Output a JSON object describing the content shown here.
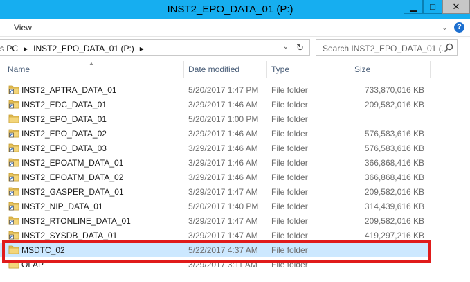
{
  "window": {
    "title": "INST2_EPO_DATA_01 (P:)",
    "controls": {
      "minimize": "▁",
      "maximize": "□",
      "close": "✕"
    }
  },
  "ribbon": {
    "tab_view": "View",
    "expand": "⌄",
    "help": "?"
  },
  "address_bar": {
    "crumbs": [
      "s PC",
      "INST2_EPO_DATA_01 (P:)"
    ],
    "separator": "▶",
    "dropdown": "⌄",
    "refresh": "↻"
  },
  "search": {
    "placeholder": "Search INST2_EPO_DATA_01 (..."
  },
  "columns": {
    "name": "Name",
    "date": "Date modified",
    "type": "Type",
    "size": "Size",
    "sort_indicator": "▲"
  },
  "rows": [
    {
      "name": "INST2_APTRA_DATA_01",
      "date": "5/20/2017 1:47 PM",
      "type": "File folder",
      "size": "733,870,016 KB",
      "icon": "folder-shortcut-icon"
    },
    {
      "name": "INST2_EDC_DATA_01",
      "date": "3/29/2017 1:46 AM",
      "type": "File folder",
      "size": "209,582,016 KB",
      "icon": "folder-shortcut-icon"
    },
    {
      "name": "INST2_EPO_DATA_01",
      "date": "5/20/2017 1:00 PM",
      "type": "File folder",
      "size": "",
      "icon": "folder-icon"
    },
    {
      "name": "INST2_EPO_DATA_02",
      "date": "3/29/2017 1:46 AM",
      "type": "File folder",
      "size": "576,583,616 KB",
      "icon": "folder-shortcut-icon"
    },
    {
      "name": "INST2_EPO_DATA_03",
      "date": "3/29/2017 1:46 AM",
      "type": "File folder",
      "size": "576,583,616 KB",
      "icon": "folder-shortcut-icon"
    },
    {
      "name": "INST2_EPOATM_DATA_01",
      "date": "3/29/2017 1:46 AM",
      "type": "File folder",
      "size": "366,868,416 KB",
      "icon": "folder-shortcut-icon"
    },
    {
      "name": "INST2_EPOATM_DATA_02",
      "date": "3/29/2017 1:46 AM",
      "type": "File folder",
      "size": "366,868,416 KB",
      "icon": "folder-shortcut-icon"
    },
    {
      "name": "INST2_GASPER_DATA_01",
      "date": "3/29/2017 1:47 AM",
      "type": "File folder",
      "size": "209,582,016 KB",
      "icon": "folder-shortcut-icon"
    },
    {
      "name": "INST2_NIP_DATA_01",
      "date": "5/20/2017 1:40 PM",
      "type": "File folder",
      "size": "314,439,616 KB",
      "icon": "folder-shortcut-icon"
    },
    {
      "name": "INST2_RTONLINE_DATA_01",
      "date": "3/29/2017 1:47 AM",
      "type": "File folder",
      "size": "209,582,016 KB",
      "icon": "folder-shortcut-icon"
    },
    {
      "name": "INST2_SYSDB_DATA_01",
      "date": "3/29/2017 1:47 AM",
      "type": "File folder",
      "size": "419,297,216 KB",
      "icon": "folder-shortcut-icon"
    },
    {
      "name": "MSDTC_02",
      "date": "5/22/2017 4:37 AM",
      "type": "File folder",
      "size": "",
      "icon": "folder-icon",
      "selected": true
    },
    {
      "name": "OLAP",
      "date": "3/29/2017 3:11 AM",
      "type": "File folder",
      "size": "",
      "icon": "folder-icon"
    }
  ],
  "colors": {
    "titlebar": "#16aef0",
    "selection": "#cce8ff",
    "highlight_box": "#e01b1b",
    "folder": "#e8c25a"
  }
}
